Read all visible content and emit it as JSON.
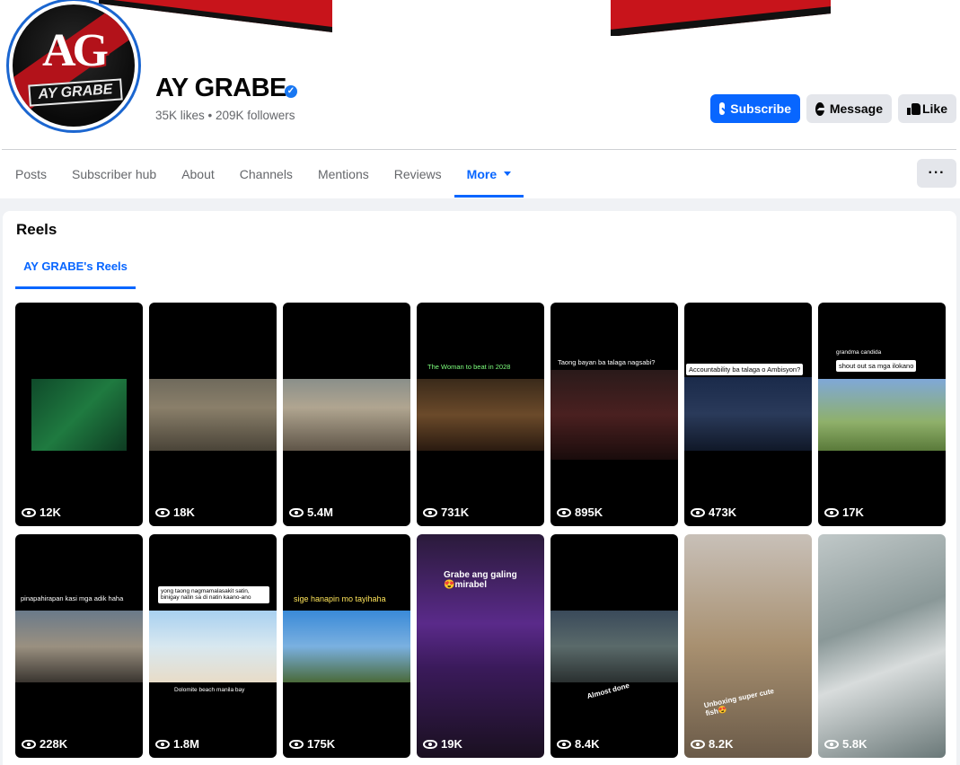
{
  "page": {
    "name": "AY GRABE",
    "stats": "35K likes • 209K followers",
    "logo_text": "AG",
    "logo_subtext": "AY GRABE"
  },
  "actions": {
    "subscribe": "Subscribe",
    "message": "Message",
    "like": "Like",
    "more_options": "···"
  },
  "tabs": [
    "Posts",
    "Subscriber hub",
    "About",
    "Channels",
    "Mentions",
    "Reviews",
    "More"
  ],
  "reels": {
    "title": "Reels",
    "tab": "AY GRABE's Reels",
    "items": [
      {
        "views": "12K",
        "caption": ""
      },
      {
        "views": "18K",
        "caption": ""
      },
      {
        "views": "5.4M",
        "caption": ""
      },
      {
        "views": "731K",
        "caption": "The Woman to beat in 2028"
      },
      {
        "views": "895K",
        "caption": "Taong bayan ba talaga nagsabi?"
      },
      {
        "views": "473K",
        "caption": "Accountability ba talaga o Ambisyon?"
      },
      {
        "views": "17K",
        "caption": "shout out sa mga ilokano",
        "subcaption": "grandma candida"
      },
      {
        "views": "228K",
        "caption": "pinapahirapan kasi mga adik haha"
      },
      {
        "views": "1.8M",
        "caption": "yong taong nagmamalasakit satin, binigay natin sa di natin kaano-ano",
        "subcaption": "Dolomite beach manila bay"
      },
      {
        "views": "175K",
        "caption": "sige hanapin mo tayihaha"
      },
      {
        "views": "19K",
        "caption": "Grabe ang galing 😍mirabel"
      },
      {
        "views": "8.4K",
        "caption": "Almost done"
      },
      {
        "views": "8.2K",
        "caption": "Unboxing super cute fish😍"
      },
      {
        "views": "5.8K",
        "caption": ""
      }
    ]
  },
  "colors": {
    "accent": "#0866ff",
    "brand_red": "#c8141b",
    "button_gray": "#e4e6eb",
    "muted_text": "#65676b"
  }
}
